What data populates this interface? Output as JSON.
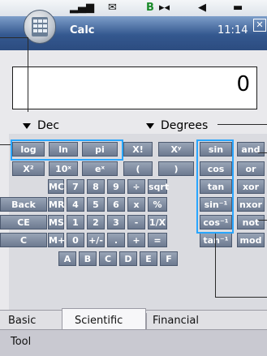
{
  "status": {
    "icons": [
      "signal-icon",
      "mail-icon",
      "bluetooth-icon",
      "phone-icon",
      "speaker-icon",
      "battery-icon"
    ]
  },
  "titlebar": {
    "title": "Calc",
    "time": "11:14",
    "close": "✕"
  },
  "display": {
    "value": "0"
  },
  "selectors": {
    "base": "Dec",
    "angle": "Degrees"
  },
  "keys": {
    "row1": [
      "log",
      "ln",
      "pi",
      "X!",
      "Xʸ",
      "sin",
      "and"
    ],
    "row2": [
      "X²",
      "10ˣ",
      "eˣ",
      "(",
      ")",
      "cos",
      "or"
    ],
    "row3": [
      "MC",
      "7",
      "8",
      "9",
      "÷",
      "sqrt",
      "tan",
      "xor"
    ],
    "row4": [
      "Back",
      "MR",
      "4",
      "5",
      "6",
      "x",
      "%",
      "sin⁻¹",
      "nxor"
    ],
    "row5": [
      "CE",
      "MS",
      "1",
      "2",
      "3",
      "-",
      "1/X",
      "cos⁻¹",
      "not"
    ],
    "row6": [
      "C",
      "M+",
      "0",
      "+/-",
      ".",
      "+",
      "=",
      "tan⁻¹",
      "mod"
    ],
    "row7": [
      "A",
      "B",
      "C",
      "D",
      "E",
      "F"
    ]
  },
  "tabs": [
    "Basic",
    "Scientific",
    "Financial"
  ],
  "active_tab": "Scientific",
  "toolbar": {
    "label": "Tool"
  },
  "colors": {
    "titlebar": "#34588f",
    "key": "#7c889d",
    "highlight": "#29a6ff"
  }
}
